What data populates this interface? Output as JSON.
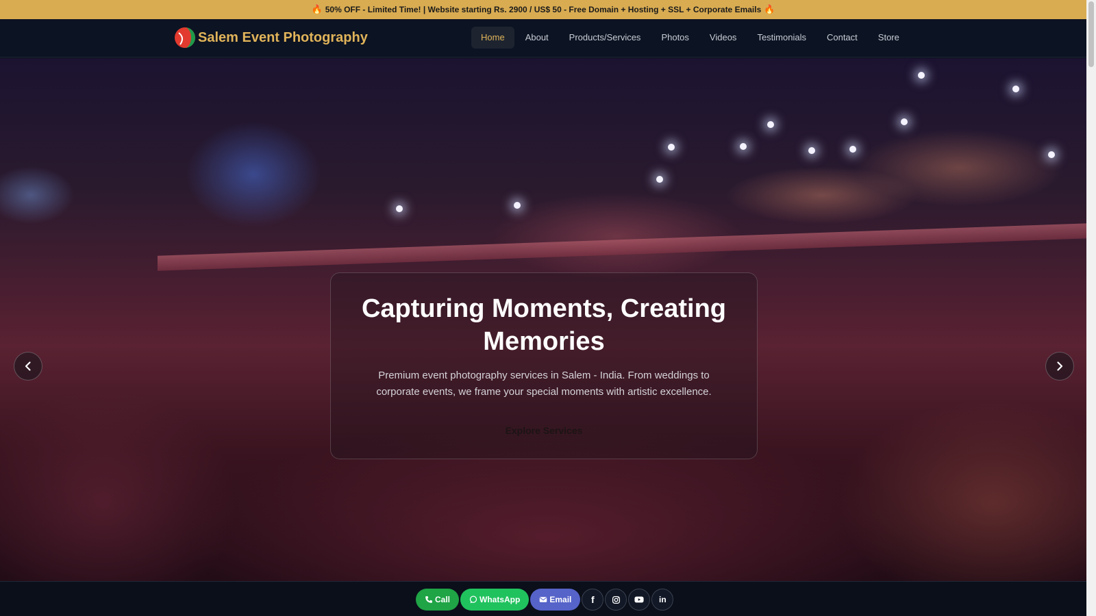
{
  "promo": {
    "text": "50% OFF - Limited Time! | Website starting Rs. 2900 / US$ 50 - Free Domain + Hosting + SSL + Corporate Emails",
    "icon": "fire-icon"
  },
  "header": {
    "brand": "Salem Event Photography",
    "nav": [
      {
        "label": "Home",
        "active": true
      },
      {
        "label": "About"
      },
      {
        "label": "Products/Services"
      },
      {
        "label": "Photos"
      },
      {
        "label": "Videos"
      },
      {
        "label": "Testimonials"
      },
      {
        "label": "Contact"
      },
      {
        "label": "Store"
      }
    ]
  },
  "hero": {
    "title": "Capturing Moments, Creating Memories",
    "subtitle": "Premium event photography services in Salem - India. From weddings to corporate events, we frame your special moments with artistic excellence.",
    "button": "Explore Services",
    "prev_icon": "chevron-left-icon",
    "next_icon": "chevron-right-icon"
  },
  "contact_bar": {
    "call": "Call",
    "whatsapp": "WhatsApp",
    "email": "Email",
    "socials": [
      "facebook-icon",
      "instagram-icon",
      "youtube-icon",
      "linkedin-icon"
    ]
  },
  "colors": {
    "promo_bg": "#d9ac52",
    "brand": "#e1b45a",
    "nav_bg": "#0c1322",
    "call": "#1fa446",
    "whatsapp": "#20c25e",
    "email": "#5663c9"
  }
}
